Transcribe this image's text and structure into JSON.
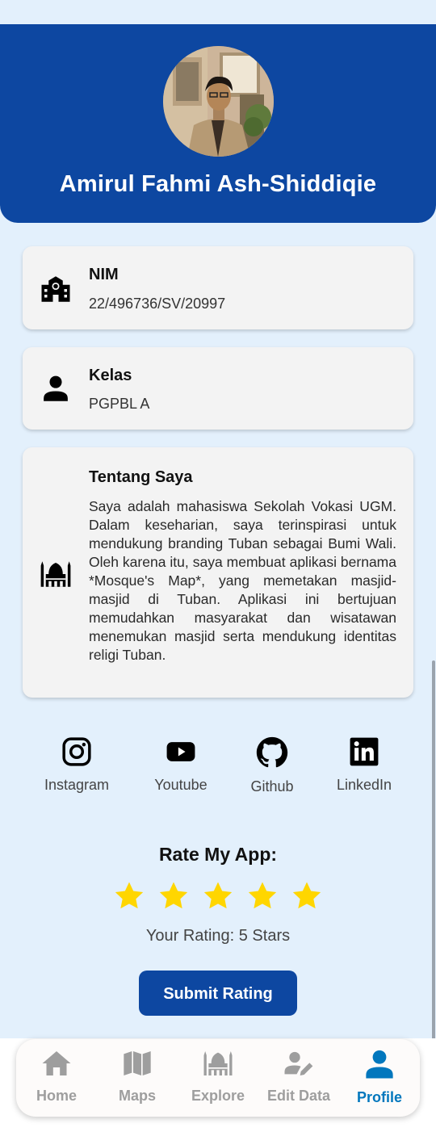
{
  "profile": {
    "name": "Amirul Fahmi Ash-Shiddiqie"
  },
  "cards": {
    "nim": {
      "title": "NIM",
      "value": "22/496736/SV/20997",
      "icon": "school-building-icon"
    },
    "kelas": {
      "title": "Kelas",
      "value": "PGPBL A",
      "icon": "person-icon"
    },
    "about": {
      "title": "Tentang Saya",
      "text": "Saya adalah mahasiswa Sekolah Vokasi UGM. Dalam keseharian, saya terinspirasi untuk mendukung branding Tuban sebagai Bumi Wali. Oleh karena itu, saya membuat aplikasi bernama *Mosque's Map*, yang memetakan masjid-masjid di Tuban. Aplikasi ini bertujuan memudahkan masyarakat dan wisatawan menemukan masjid serta mendukung identitas religi Tuban.",
      "icon": "mosque-icon"
    }
  },
  "social": [
    {
      "label": "Instagram",
      "icon": "instagram-icon"
    },
    {
      "label": "Youtube",
      "icon": "youtube-icon"
    },
    {
      "label": "Github",
      "icon": "github-icon"
    },
    {
      "label": "LinkedIn",
      "icon": "linkedin-icon"
    }
  ],
  "rating": {
    "title": "Rate My App:",
    "stars": 5,
    "max_stars": 5,
    "text": "Your Rating: 5 Stars",
    "submit_label": "Submit Rating"
  },
  "nav": {
    "items": [
      {
        "label": "Home",
        "icon": "home-icon",
        "active": false
      },
      {
        "label": "Maps",
        "icon": "map-icon",
        "active": false
      },
      {
        "label": "Explore",
        "icon": "mosque-icon",
        "active": false
      },
      {
        "label": "Edit Data",
        "icon": "edit-user-icon",
        "active": false
      },
      {
        "label": "Profile",
        "icon": "profile-icon",
        "active": true
      }
    ]
  },
  "colors": {
    "primary": "#0d47a1",
    "background": "#e3f0fc",
    "star": "#ffd600",
    "nav_active": "#0277bd",
    "nav_inactive": "#9e9e9e"
  }
}
